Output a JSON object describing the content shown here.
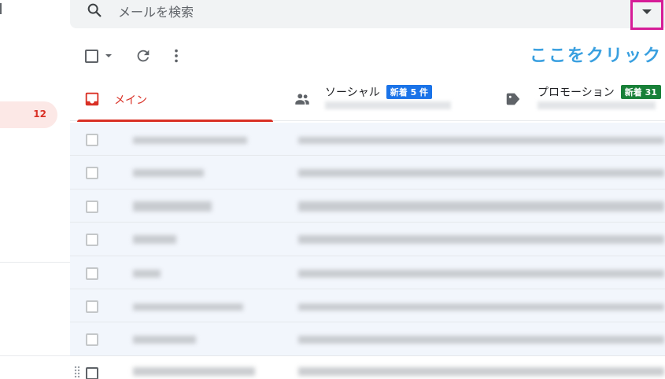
{
  "search": {
    "placeholder": "メールを検索",
    "icon": "search-icon",
    "options_icon": "caret-down-icon"
  },
  "sidebar": {
    "active_count": "12"
  },
  "toolbar": {
    "icons": [
      "checkbox-icon",
      "caret-down-icon",
      "refresh-icon",
      "more-vert-icon"
    ]
  },
  "annotation": {
    "text": "ここをクリック",
    "color": "#3aa0e0",
    "highlight_color": "#d61c97"
  },
  "tabs": [
    {
      "label": "メイン",
      "icon": "inbox-icon",
      "color": "#d93025"
    },
    {
      "label": "ソーシャル",
      "icon": "people-icon",
      "badge": "新着 5 件",
      "badge_color": "#1a73e8"
    },
    {
      "label": "プロモーション",
      "icon": "tag-icon",
      "badge": "新着 31",
      "badge_color": "#188038"
    }
  ],
  "mail_rows_count": 8
}
